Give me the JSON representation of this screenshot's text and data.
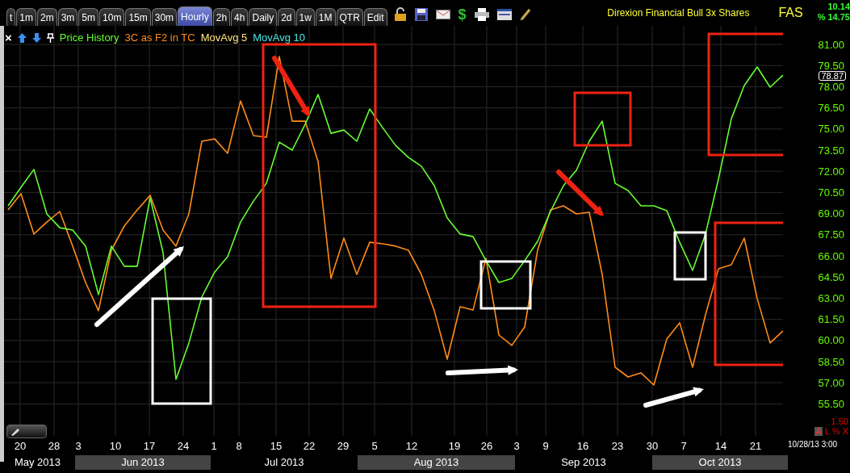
{
  "toolbar": {
    "tabs": [
      {
        "label": "t",
        "selected": false
      },
      {
        "label": "1m",
        "selected": false
      },
      {
        "label": "2m",
        "selected": false
      },
      {
        "label": "3m",
        "selected": false
      },
      {
        "label": "5m",
        "selected": false
      },
      {
        "label": "10m",
        "selected": false
      },
      {
        "label": "15m",
        "selected": false
      },
      {
        "label": "30m",
        "selected": false
      },
      {
        "label": "Hourly",
        "selected": true
      },
      {
        "label": "2h",
        "selected": false
      },
      {
        "label": "4h",
        "selected": false
      },
      {
        "label": "Daily",
        "selected": false
      },
      {
        "label": "2d",
        "selected": false
      },
      {
        "label": "1w",
        "selected": false
      },
      {
        "label": "1M",
        "selected": false
      },
      {
        "label": "QTR",
        "selected": false
      },
      {
        "label": "Edit",
        "selected": false
      }
    ],
    "dollar_button": "$"
  },
  "header": {
    "title": "Direxion Financial Bull 3x Shares",
    "symbol": "FAS",
    "change": "10.14",
    "change_percent": "% 14.75"
  },
  "legend": {
    "close": "×",
    "items": [
      {
        "label": "MovAvg 5",
        "color": "#ffe680"
      },
      {
        "label": "MovAvg 10",
        "color": "#4de6e6"
      }
    ]
  },
  "chart_data": {
    "type": "line",
    "ylim": [
      53.23,
      82.32
    ],
    "grid": true,
    "series": [
      {
        "name": "Price History",
        "color": "#66ff33",
        "values": [
          69.55,
          70.87,
          72.13,
          68.98,
          68.0,
          67.83,
          66.69,
          63.25,
          66.69,
          65.26,
          65.26,
          70.12,
          66.23,
          57.24,
          59.82,
          63.08,
          64.86,
          65.94,
          68.4,
          69.89,
          71.15,
          74.07,
          73.5,
          75.33,
          77.45,
          74.7,
          74.93,
          74.13,
          76.42,
          75.1,
          73.84,
          72.98,
          72.36,
          70.98,
          68.69,
          67.55,
          67.37,
          65.66,
          64.11,
          64.4,
          65.66,
          67.03,
          69.15,
          70.98,
          72.07,
          74.13,
          75.56,
          71.15,
          70.64,
          69.55,
          69.55,
          69.21,
          66.97,
          64.97,
          67.55,
          71.44,
          75.73,
          78.08,
          79.4,
          77.97,
          78.82
        ]
      },
      {
        "name": "3C as F2 in TC",
        "color": "#ff8c1a",
        "values": [
          69.26,
          70.41,
          67.55,
          68.4,
          69.15,
          66.69,
          64.11,
          62.11,
          66.4,
          68.12,
          69.26,
          70.29,
          67.83,
          66.69,
          68.98,
          74.13,
          74.3,
          73.27,
          76.99,
          74.53,
          74.42,
          80.14,
          75.56,
          75.56,
          72.7,
          64.4,
          67.26,
          64.68,
          66.97,
          66.86,
          66.69,
          66.4,
          64.68,
          62.11,
          58.67,
          62.39,
          62.16,
          65.83,
          60.39,
          59.65,
          60.96,
          66.4,
          69.26,
          69.55,
          68.98,
          69.09,
          64.68,
          58.1,
          57.41,
          57.7,
          56.84,
          60.1,
          61.25,
          58.1,
          61.82,
          65.08,
          65.37,
          67.26,
          62.97,
          59.82,
          60.68
        ]
      }
    ],
    "yticks": [
      {
        "value": 81,
        "label": "81.00"
      },
      {
        "value": 79.5,
        "label": "79.50"
      },
      {
        "value": 78,
        "label": "78.00"
      },
      {
        "value": 76.5,
        "label": "76.50"
      },
      {
        "value": 75,
        "label": "75.00"
      },
      {
        "value": 73.5,
        "label": "73.50"
      },
      {
        "value": 72,
        "label": "72.00"
      },
      {
        "value": 70.5,
        "label": "70.50"
      },
      {
        "value": 69,
        "label": "69.00"
      },
      {
        "value": 67.5,
        "label": "67.50"
      },
      {
        "value": 66,
        "label": "66.00"
      },
      {
        "value": 64.5,
        "label": "64.50"
      },
      {
        "value": 63,
        "label": "63.00"
      },
      {
        "value": 61.5,
        "label": "61.50"
      },
      {
        "value": 60,
        "label": "60.00"
      },
      {
        "value": 58.5,
        "label": "58.50"
      },
      {
        "value": 57,
        "label": "57.00"
      },
      {
        "value": 55.5,
        "label": "55.50"
      }
    ]
  },
  "price_axis": {
    "last_price": "78.87",
    "scale": "1.50",
    "buttons": [
      "A",
      "L",
      "%",
      "X"
    ]
  },
  "date_axis": {
    "days": [
      "20",
      "28",
      "3",
      "10",
      "17",
      "24",
      "1",
      "8",
      "15",
      "22",
      "29",
      "5",
      "12",
      "19",
      "26",
      "3",
      "9",
      "16",
      "23",
      "30",
      "7",
      "14",
      "21"
    ],
    "timestamp": "10/28/13 3:00",
    "months": [
      "May 2013",
      "Jun 2013",
      "Jul 2013",
      "Aug 2013",
      "Sep 2013",
      "Oct 2013"
    ]
  }
}
